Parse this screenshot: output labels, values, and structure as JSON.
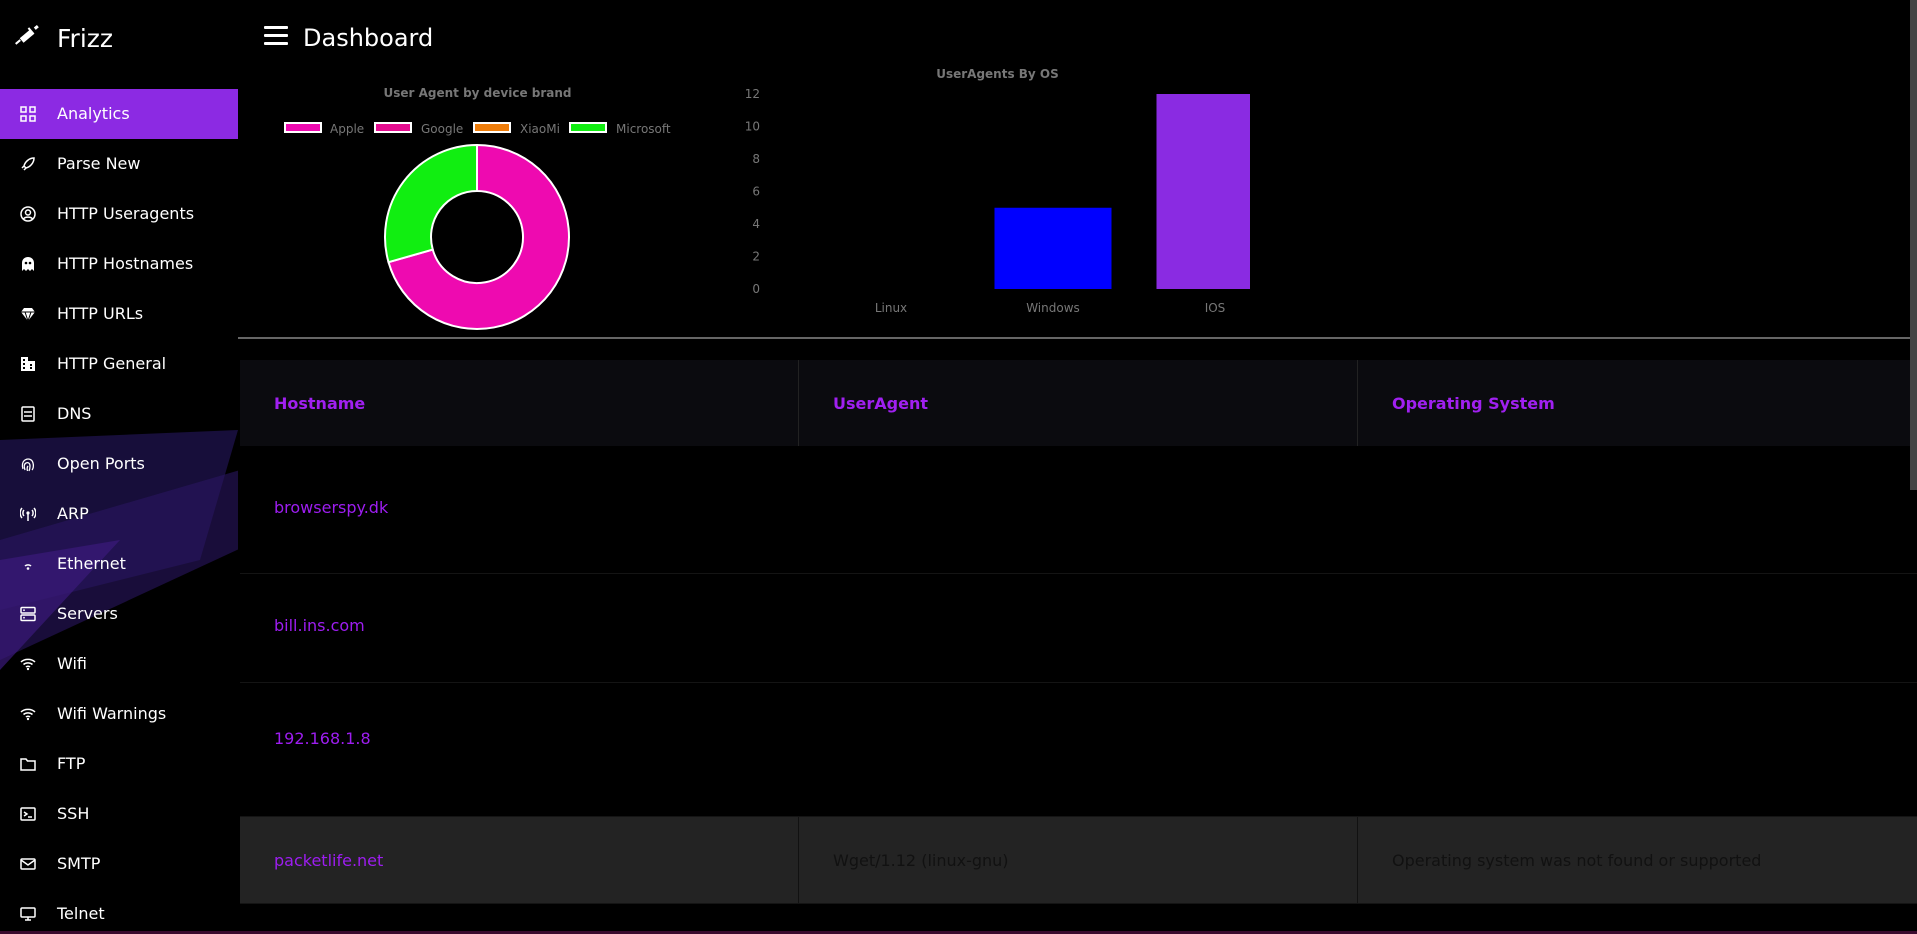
{
  "app": {
    "title": "Frizz",
    "logo_icon": "syringe-icon"
  },
  "header": {
    "page_title": "Dashboard",
    "menu_icon": "hamburger-icon"
  },
  "sidebar": {
    "items": [
      {
        "label": "Analytics",
        "icon": "grid-icon",
        "active": true
      },
      {
        "label": "Parse New",
        "icon": "rocket-icon"
      },
      {
        "label": "HTTP Useragents",
        "icon": "user-circle-icon"
      },
      {
        "label": "HTTP Hostnames",
        "icon": "ghost-icon"
      },
      {
        "label": "HTTP URLs",
        "icon": "diamond-icon"
      },
      {
        "label": "HTTP General",
        "icon": "building-icon"
      },
      {
        "label": "DNS",
        "icon": "server-doc-icon"
      },
      {
        "label": "Open Ports",
        "icon": "fingerprint-icon"
      },
      {
        "label": "ARP",
        "icon": "antenna-icon"
      },
      {
        "label": "Ethernet",
        "icon": "signal-small-icon"
      },
      {
        "label": "Servers",
        "icon": "server-icon"
      },
      {
        "label": "Wifi",
        "icon": "wifi-icon"
      },
      {
        "label": "Wifi Warnings",
        "icon": "wifi-warning-icon"
      },
      {
        "label": "FTP",
        "icon": "folder-icon"
      },
      {
        "label": "SSH",
        "icon": "terminal-icon"
      },
      {
        "label": "SMTP",
        "icon": "mail-icon"
      },
      {
        "label": "Telnet",
        "icon": "monitor-icon"
      }
    ],
    "active_color": "#8c2ae3"
  },
  "chart_data": [
    {
      "type": "pie",
      "title": "User Agent by device brand",
      "legend_position": "top",
      "categories": [
        "Apple",
        "Google",
        "XiaoMi",
        "Microsoft"
      ],
      "values": [
        12,
        0,
        0,
        5
      ],
      "colors": [
        "#ee0ab0",
        "#e40c8f",
        "#ef7d0a",
        "#11ee11"
      ]
    },
    {
      "type": "bar",
      "title": "UserAgents By OS",
      "categories": [
        "Linux",
        "Windows",
        "IOS"
      ],
      "values": [
        0,
        5,
        12
      ],
      "colors": [
        "#000000",
        "#0000ff",
        "#8a2be2"
      ],
      "ylim": [
        0,
        12
      ],
      "yticks": [
        0,
        2,
        4,
        6,
        8,
        10,
        12
      ],
      "grid": false
    }
  ],
  "table": {
    "headers": [
      "Hostname",
      "UserAgent",
      "Operating System"
    ],
    "rows": [
      {
        "hostname": "browserspy.dk",
        "useragent": "",
        "os": ""
      },
      {
        "hostname": "bill.ins.com",
        "useragent": "",
        "os": ""
      },
      {
        "hostname": "192.168.1.8",
        "useragent": "",
        "os": ""
      },
      {
        "hostname": "packetlife.net",
        "useragent": "Wget/1.12 (linux-gnu)",
        "os": "Operating system was not found or supported"
      }
    ]
  }
}
